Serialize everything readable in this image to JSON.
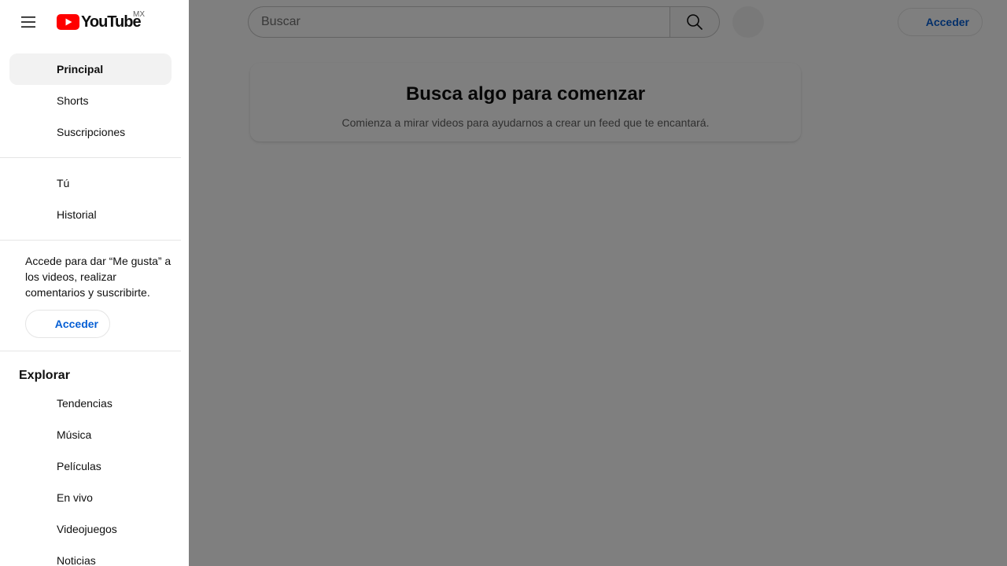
{
  "masthead": {
    "search_placeholder": "Buscar",
    "signin_label": "Acceder",
    "logo_text": "YouTube",
    "country_code": "MX"
  },
  "feed": {
    "title": "Busca algo para comenzar",
    "subtitle": "Comienza a mirar videos para ayudarnos a crear un feed que te encantará."
  },
  "sidebar": {
    "main_items": [
      {
        "label": "Principal",
        "active": true
      },
      {
        "label": "Shorts"
      },
      {
        "label": "Suscripciones"
      }
    ],
    "you_items": [
      {
        "label": "Tú"
      },
      {
        "label": "Historial"
      }
    ],
    "signin_prompt": "Accede para dar “Me gusta” a los videos, realizar comentarios y suscribirte.",
    "signin_label": "Acceder",
    "explore_title": "Explorar",
    "explore_items": [
      {
        "label": "Tendencias"
      },
      {
        "label": "Música"
      },
      {
        "label": "Películas"
      },
      {
        "label": "En vivo"
      },
      {
        "label": "Videojuegos"
      },
      {
        "label": "Noticias"
      }
    ]
  },
  "colors": {
    "brand_red": "#ff0000",
    "link_blue": "#065fd4",
    "scrim": "rgba(0,0,0,0.5)"
  }
}
